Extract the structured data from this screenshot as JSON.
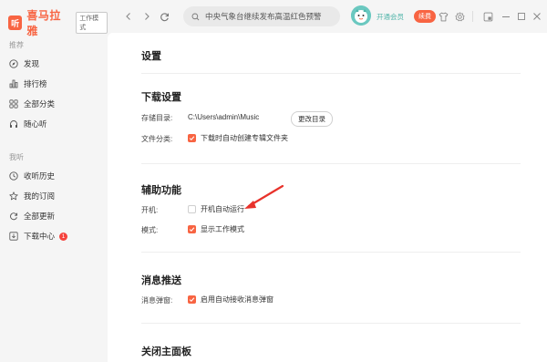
{
  "app": {
    "logo_char": "听",
    "name": "喜马拉雅",
    "mode_badge": "工作模式"
  },
  "sidebar": {
    "section_recommend": "推荐",
    "section_mine": "我听",
    "items": [
      {
        "label": "发现",
        "icon": "compass-icon"
      },
      {
        "label": "排行榜",
        "icon": "chart-bar-icon"
      },
      {
        "label": "全部分类",
        "icon": "grid-icon"
      },
      {
        "label": "随心听",
        "icon": "headphones-icon"
      },
      {
        "label": "收听历史",
        "icon": "clock-icon"
      },
      {
        "label": "我的订阅",
        "icon": "star-icon"
      },
      {
        "label": "全部更新",
        "icon": "refresh-icon"
      },
      {
        "label": "下载中心",
        "icon": "download-icon",
        "badge": "1"
      }
    ]
  },
  "topbar": {
    "search_placeholder": "中央气象台继续发布高温红色预警",
    "vip_label": "开通会员",
    "renew_label": "续费"
  },
  "settings": {
    "title": "设置",
    "download": {
      "title": "下载设置",
      "dir_label": "存储目录:",
      "dir_path": "C:\\Users\\admin\\Music",
      "change_btn": "更改目录",
      "category_label": "文件分类:",
      "category_option": "下载时自动创建专辑文件夹",
      "category_checked": true
    },
    "assist": {
      "title": "辅助功能",
      "boot_label": "开机:",
      "boot_option": "开机自动运行",
      "boot_checked": false,
      "mode_label": "模式:",
      "mode_option": "显示工作模式",
      "mode_checked": true
    },
    "push": {
      "title": "消息推送",
      "popup_label": "消息弹窗:",
      "popup_option": "启用自动接收消息弹窗",
      "popup_checked": true
    },
    "close": {
      "title": "关闭主面板"
    }
  },
  "colors": {
    "accent": "#f86442",
    "vip": "#4db3a8",
    "annotation_arrow": "#e8322b"
  }
}
